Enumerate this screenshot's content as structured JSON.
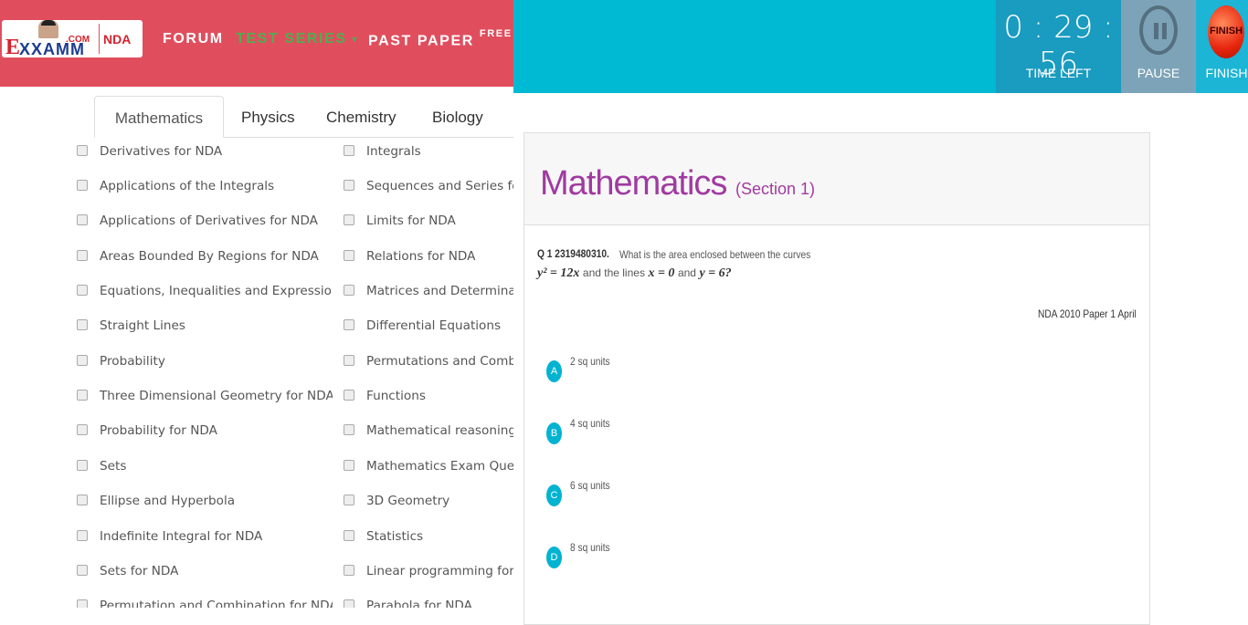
{
  "brand": {
    "logo_e": "E",
    "logo_text": "XXAMM",
    "logo_com": ".COM",
    "logo_nda": "NDA"
  },
  "nav": {
    "forum": "FORUM",
    "test_series": "TEST SERIES",
    "past_paper": "PAST PAPER",
    "past_paper_sup": "FREE"
  },
  "subject_tabs": [
    "Mathematics",
    "Physics",
    "Chemistry",
    "Biology"
  ],
  "topics_col1": [
    "Derivatives for NDA",
    "Applications of the Integrals",
    "Applications of Derivatives for NDA",
    "Areas Bounded By Regions for NDA",
    "Equations, Inequalities and Expressions",
    "Straight Lines",
    "Probability",
    "Three Dimensional Geometry for NDA",
    "Probability for NDA",
    "Sets",
    "Ellipse and Hyperbola",
    "Indefinite Integral for NDA",
    "Sets for NDA",
    "Permutation and Combination for NDA"
  ],
  "topics_col2": [
    "Integrals",
    "Sequences and Series for",
    "Limits for NDA",
    "Relations for NDA",
    "Matrices and Determinant",
    "Differential Equations",
    "Permutations and Combin",
    "Functions",
    "Mathematical reasoning fo",
    "Mathematics Exam Questi",
    "3D Geometry",
    "Statistics",
    "Linear programming for N",
    "Parabola for NDA"
  ],
  "timer": {
    "time": "0:29:56",
    "time_label": "TIME LEFT",
    "pause_label": "PAUSE",
    "finish_icon_text": "FINISH",
    "finish_label": "FINISH"
  },
  "section": {
    "title": "Mathematics",
    "subtitle": "(Section 1)"
  },
  "question": {
    "number": "Q 1 2319480310.",
    "text": "What is the area enclosed between the curves",
    "math_1": "y² = 12x",
    "math_join_1": "and the lines",
    "math_2": "x = 0",
    "math_join_2": "and",
    "math_3": "y = 6?",
    "source": "NDA 2010 Paper 1 April"
  },
  "options": [
    {
      "letter": "A",
      "text": "2 sq units"
    },
    {
      "letter": "B",
      "text": "4 sq units"
    },
    {
      "letter": "C",
      "text": "6 sq units"
    },
    {
      "letter": "D",
      "text": "8 sq units"
    }
  ],
  "colors": {
    "navbar": "#e04e5e",
    "header_accent": "#00b9d2",
    "section_title": "#a03aa0",
    "option_badge": "#00b3d1"
  }
}
